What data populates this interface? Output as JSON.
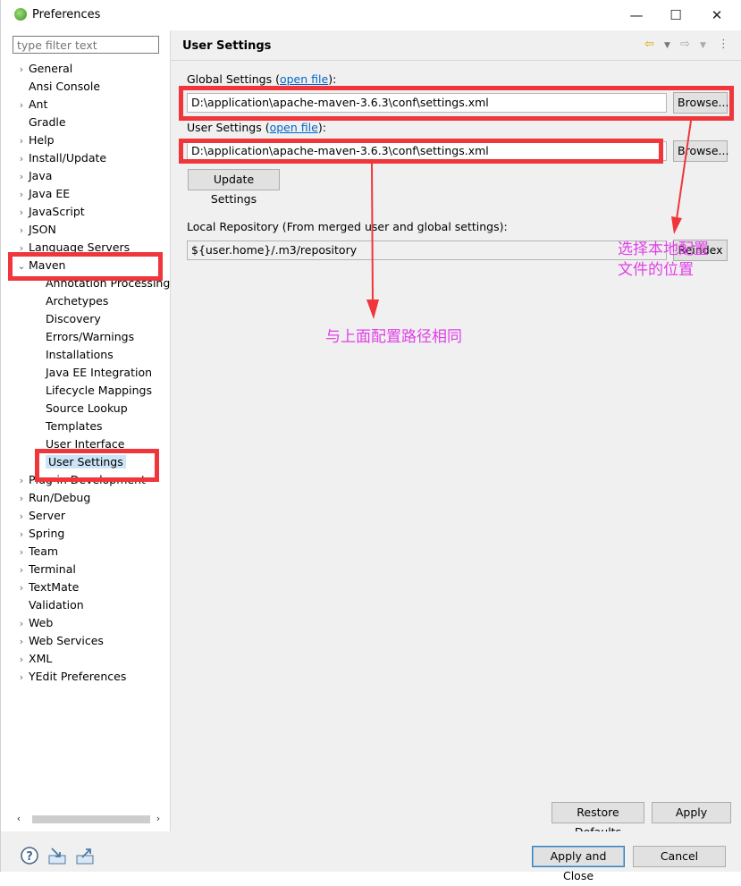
{
  "window": {
    "title": "Preferences"
  },
  "filter": {
    "placeholder": "type filter text"
  },
  "tree": [
    {
      "label": "General",
      "chevron": "›",
      "indent": 0
    },
    {
      "label": "Ansi Console",
      "chevron": "",
      "indent": 0
    },
    {
      "label": "Ant",
      "chevron": "›",
      "indent": 0
    },
    {
      "label": "Gradle",
      "chevron": "",
      "indent": 0
    },
    {
      "label": "Help",
      "chevron": "›",
      "indent": 0
    },
    {
      "label": "Install/Update",
      "chevron": "›",
      "indent": 0
    },
    {
      "label": "Java",
      "chevron": "›",
      "indent": 0
    },
    {
      "label": "Java EE",
      "chevron": "›",
      "indent": 0
    },
    {
      "label": "JavaScript",
      "chevron": "›",
      "indent": 0
    },
    {
      "label": "JSON",
      "chevron": "›",
      "indent": 0
    },
    {
      "label": "Language Servers",
      "chevron": "›",
      "indent": 0
    },
    {
      "label": "Maven",
      "chevron": "⌄",
      "indent": 0
    },
    {
      "label": "Annotation Processing",
      "chevron": "",
      "indent": 1
    },
    {
      "label": "Archetypes",
      "chevron": "",
      "indent": 1
    },
    {
      "label": "Discovery",
      "chevron": "",
      "indent": 1
    },
    {
      "label": "Errors/Warnings",
      "chevron": "",
      "indent": 1
    },
    {
      "label": "Installations",
      "chevron": "",
      "indent": 1
    },
    {
      "label": "Java EE Integration",
      "chevron": "",
      "indent": 1
    },
    {
      "label": "Lifecycle Mappings",
      "chevron": "",
      "indent": 1
    },
    {
      "label": "Source Lookup",
      "chevron": "",
      "indent": 1
    },
    {
      "label": "Templates",
      "chevron": "",
      "indent": 1
    },
    {
      "label": "User Interface",
      "chevron": "",
      "indent": 1
    },
    {
      "label": "User Settings",
      "chevron": "",
      "indent": 1,
      "selected": true
    },
    {
      "label": "Plug-in Development",
      "chevron": "›",
      "indent": 0
    },
    {
      "label": "Run/Debug",
      "chevron": "›",
      "indent": 0
    },
    {
      "label": "Server",
      "chevron": "›",
      "indent": 0
    },
    {
      "label": "Spring",
      "chevron": "›",
      "indent": 0
    },
    {
      "label": "Team",
      "chevron": "›",
      "indent": 0
    },
    {
      "label": "Terminal",
      "chevron": "›",
      "indent": 0
    },
    {
      "label": "TextMate",
      "chevron": "›",
      "indent": 0
    },
    {
      "label": "Validation",
      "chevron": "",
      "indent": 0
    },
    {
      "label": "Web",
      "chevron": "›",
      "indent": 0
    },
    {
      "label": "Web Services",
      "chevron": "›",
      "indent": 0
    },
    {
      "label": "XML",
      "chevron": "›",
      "indent": 0
    },
    {
      "label": "YEdit Preferences",
      "chevron": "›",
      "indent": 0
    }
  ],
  "page": {
    "title": "User Settings",
    "global_label": "Global Settings (",
    "global_link": "open file",
    "global_suffix": "):",
    "global_value": "D:\\application\\apache-maven-3.6.3\\conf\\settings.xml",
    "user_label": "User Settings (",
    "user_link": "open file",
    "user_suffix": "):",
    "user_value": "D:\\application\\apache-maven-3.6.3\\conf\\settings.xml",
    "browse": "Browse...",
    "update": "Update Settings",
    "local_label": "Local Repository (From merged user and global settings):",
    "local_value": "${user.home}/.m3/repository",
    "reindex": "Reindex",
    "restore": "Restore Defaults",
    "apply": "Apply"
  },
  "bottom": {
    "apply_close": "Apply and Close",
    "cancel": "Cancel"
  },
  "annotations": {
    "right_line1": "选择本地配置",
    "right_line2": "文件的位置",
    "center": "与上面配置路径相同"
  },
  "colors": {
    "annotation_red": "#f0363a",
    "annotation_text": "#e040e8",
    "selection": "#cce4f7"
  }
}
